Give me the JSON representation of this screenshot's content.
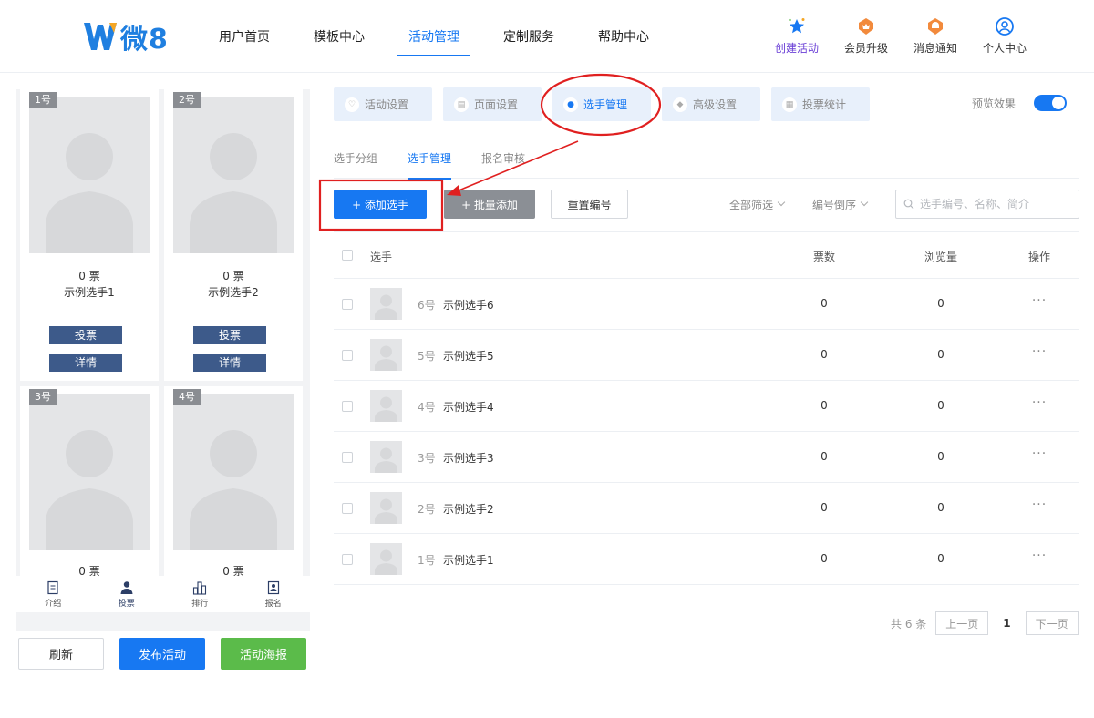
{
  "logo": {
    "text": "微8"
  },
  "nav": {
    "items": [
      {
        "label": "用户首页",
        "active": false
      },
      {
        "label": "模板中心",
        "active": false
      },
      {
        "label": "活动管理",
        "active": true
      },
      {
        "label": "定制服务",
        "active": false
      },
      {
        "label": "帮助中心",
        "active": false
      }
    ]
  },
  "header_actions": [
    {
      "label": "创建活动",
      "icon": "star-sparkle-icon"
    },
    {
      "label": "会员升级",
      "icon": "crown-badge-icon"
    },
    {
      "label": "消息通知",
      "icon": "bell-badge-icon"
    },
    {
      "label": "个人中心",
      "icon": "user-circle-icon"
    }
  ],
  "preview": {
    "cards": [
      {
        "tag": "1号",
        "votes": "0 票",
        "name": "示例选手1",
        "vote_btn": "投票",
        "detail_btn": "详情"
      },
      {
        "tag": "2号",
        "votes": "0 票",
        "name": "示例选手2",
        "vote_btn": "投票",
        "detail_btn": "详情"
      },
      {
        "tag": "3号",
        "votes": "0 票"
      },
      {
        "tag": "4号",
        "votes": "0 票"
      }
    ],
    "bottom_tabs": [
      {
        "label": "介绍",
        "icon": "document-icon"
      },
      {
        "label": "投票",
        "icon": "person-icon",
        "active": true
      },
      {
        "label": "排行",
        "icon": "bar-chart-icon"
      },
      {
        "label": "报名",
        "icon": "id-card-icon"
      }
    ]
  },
  "left_actions": {
    "refresh": "刷新",
    "publish": "发布活动",
    "poster": "活动海报"
  },
  "top_tabs": [
    {
      "label": "活动设置",
      "icon": "heart-icon"
    },
    {
      "label": "页面设置",
      "icon": "page-icon"
    },
    {
      "label": "选手管理",
      "icon": "user-icon",
      "active": true
    },
    {
      "label": "高级设置",
      "icon": "advanced-icon"
    },
    {
      "label": "投票统计",
      "icon": "stats-icon"
    }
  ],
  "preview_toggle": {
    "label": "预览效果",
    "on": true
  },
  "sub_tabs": [
    {
      "label": "选手分组"
    },
    {
      "label": "选手管理",
      "active": true
    },
    {
      "label": "报名审核"
    }
  ],
  "toolbar": {
    "add": "+ 添加选手",
    "batch": "+ 批量添加",
    "reset": "重置编号",
    "filter_all": "全部筛选",
    "sort": "编号倒序",
    "search_placeholder": "选手编号、名称、简介"
  },
  "table": {
    "headers": {
      "player": "选手",
      "votes": "票数",
      "views": "浏览量",
      "ops": "操作"
    },
    "rows": [
      {
        "num": "6号",
        "name": "示例选手6",
        "votes": "0",
        "views": "0",
        "ops": "···"
      },
      {
        "num": "5号",
        "name": "示例选手5",
        "votes": "0",
        "views": "0",
        "ops": "···"
      },
      {
        "num": "4号",
        "name": "示例选手4",
        "votes": "0",
        "views": "0",
        "ops": "···"
      },
      {
        "num": "3号",
        "name": "示例选手3",
        "votes": "0",
        "views": "0",
        "ops": "···"
      },
      {
        "num": "2号",
        "name": "示例选手2",
        "votes": "0",
        "views": "0",
        "ops": "···"
      },
      {
        "num": "1号",
        "name": "示例选手1",
        "votes": "0",
        "views": "0",
        "ops": "···"
      }
    ]
  },
  "pagination": {
    "total": "共 6 条",
    "prev": "上一页",
    "current": "1",
    "next": "下一页"
  },
  "colors": {
    "primary": "#1778f2",
    "vote_button": "#3d5a8a",
    "publish": "#1778f2",
    "poster": "#5bbb4a",
    "annotation": "#e02020"
  }
}
